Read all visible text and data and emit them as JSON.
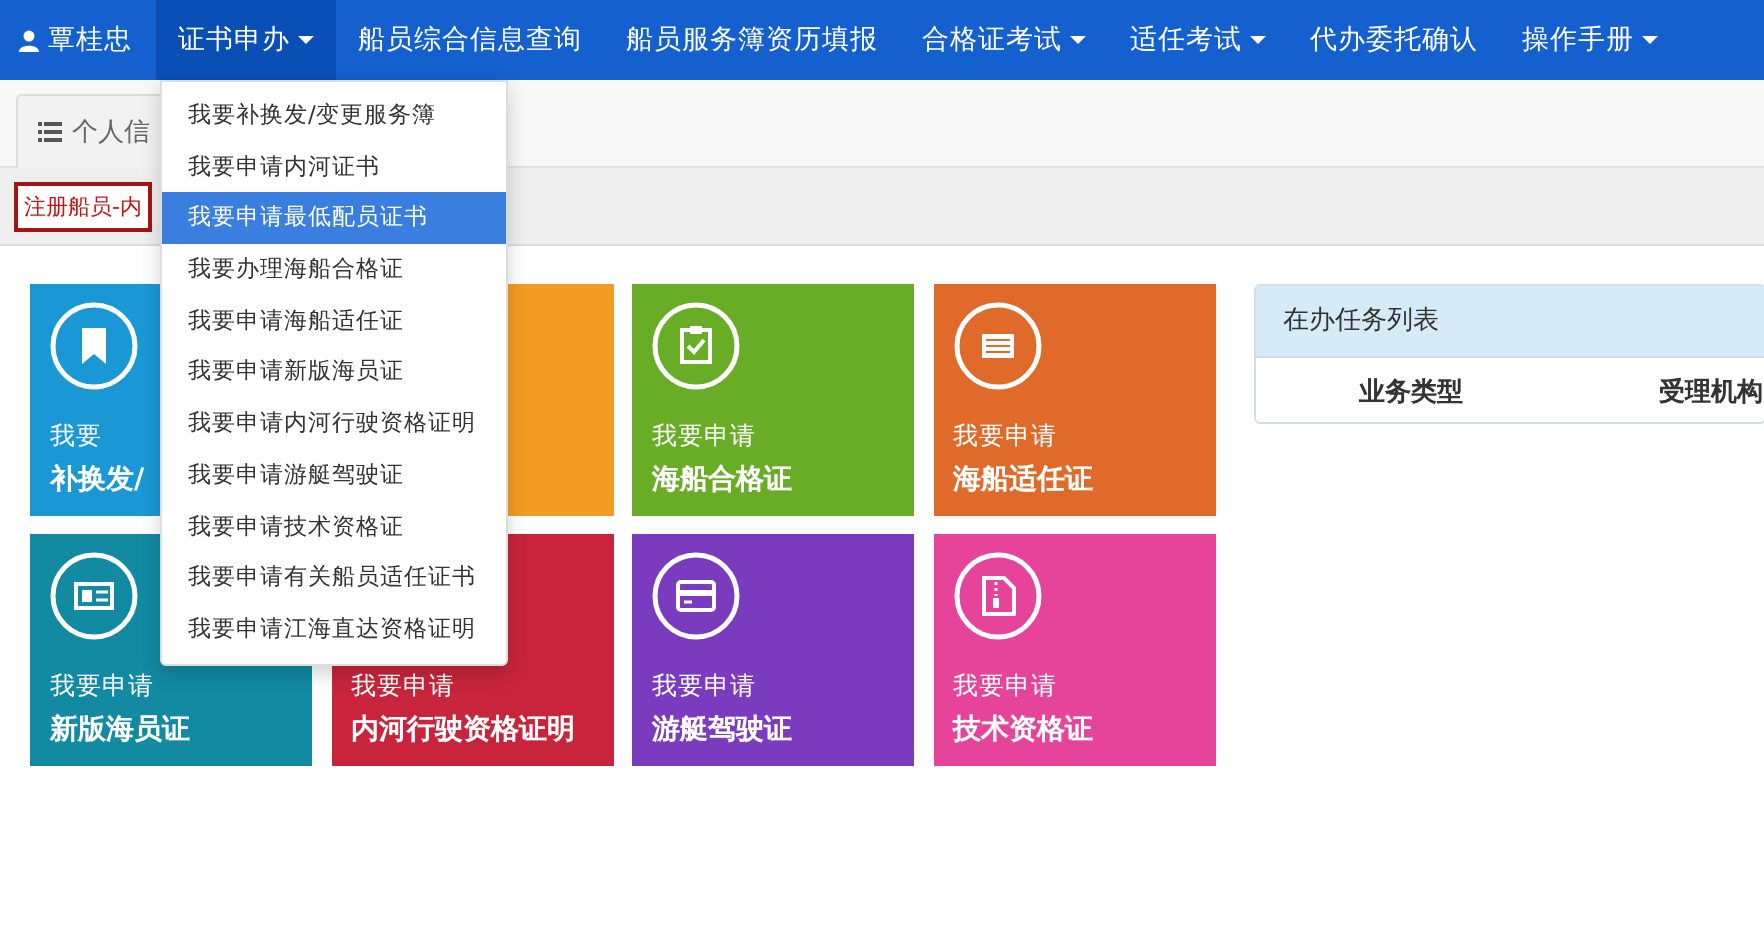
{
  "navbar": {
    "items": [
      {
        "kind": "user",
        "label": "覃桂忠",
        "selected": false
      },
      {
        "kind": "dropdown",
        "label": "证书申办",
        "selected": true
      },
      {
        "kind": "link",
        "label": "船员综合信息查询",
        "selected": false
      },
      {
        "kind": "link",
        "label": "船员服务簿资历填报",
        "selected": false
      },
      {
        "kind": "dropdown",
        "label": "合格证考试",
        "selected": false
      },
      {
        "kind": "dropdown",
        "label": "适任考试",
        "selected": false
      },
      {
        "kind": "link",
        "label": "代办委托确认",
        "selected": false
      },
      {
        "kind": "dropdown",
        "label": "操作手册",
        "selected": false
      }
    ]
  },
  "dropdown_menu": {
    "items": [
      {
        "label": "我要补换发/变更服务簿",
        "selected": false
      },
      {
        "label": "我要申请内河证书",
        "selected": false
      },
      {
        "label": "我要申请最低配员证书",
        "selected": true
      },
      {
        "label": "我要办理海船合格证",
        "selected": false
      },
      {
        "label": "我要申请海船适任证",
        "selected": false
      },
      {
        "label": "我要申请新版海员证",
        "selected": false
      },
      {
        "label": "我要申请内河行驶资格证明",
        "selected": false
      },
      {
        "label": "我要申请游艇驾驶证",
        "selected": false
      },
      {
        "label": "我要申请技术资格证",
        "selected": false
      },
      {
        "label": "我要申请有关船员适任证书",
        "selected": false
      },
      {
        "label": "我要申请江海直达资格证明",
        "selected": false
      }
    ]
  },
  "tabs": [
    {
      "label": "个人信"
    }
  ],
  "status_label": "注册船员-内",
  "tiles": [
    {
      "color": "#1a98d5",
      "kind": "bookmark",
      "line1": "我要",
      "line2": "补换发/"
    },
    {
      "color": "#f39c22",
      "kind": "none"
    },
    {
      "color": "#69ad27",
      "kind": "clipboard",
      "line1": "我要申请",
      "line2": "海船合格证"
    },
    {
      "color": "#df6a29",
      "kind": "list",
      "line1": "我要申请",
      "line2": "海船适任证"
    },
    {
      "color": "#118aa2",
      "kind": "idcard",
      "line1": "我要申请",
      "line2": "新版海员证"
    },
    {
      "color": "#c8243b",
      "kind": "none",
      "line1": "我要申请",
      "line2": "内河行驶资格证明"
    },
    {
      "color": "#7b3bbf",
      "kind": "card",
      "line1": "我要申请",
      "line2": "游艇驾驶证"
    },
    {
      "color": "#e6449a",
      "kind": "zipfile",
      "line1": "我要申请",
      "line2": "技术资格证"
    }
  ],
  "task_panel": {
    "title": "在办任务列表",
    "columns": [
      "业务类型",
      "受理机构"
    ]
  }
}
